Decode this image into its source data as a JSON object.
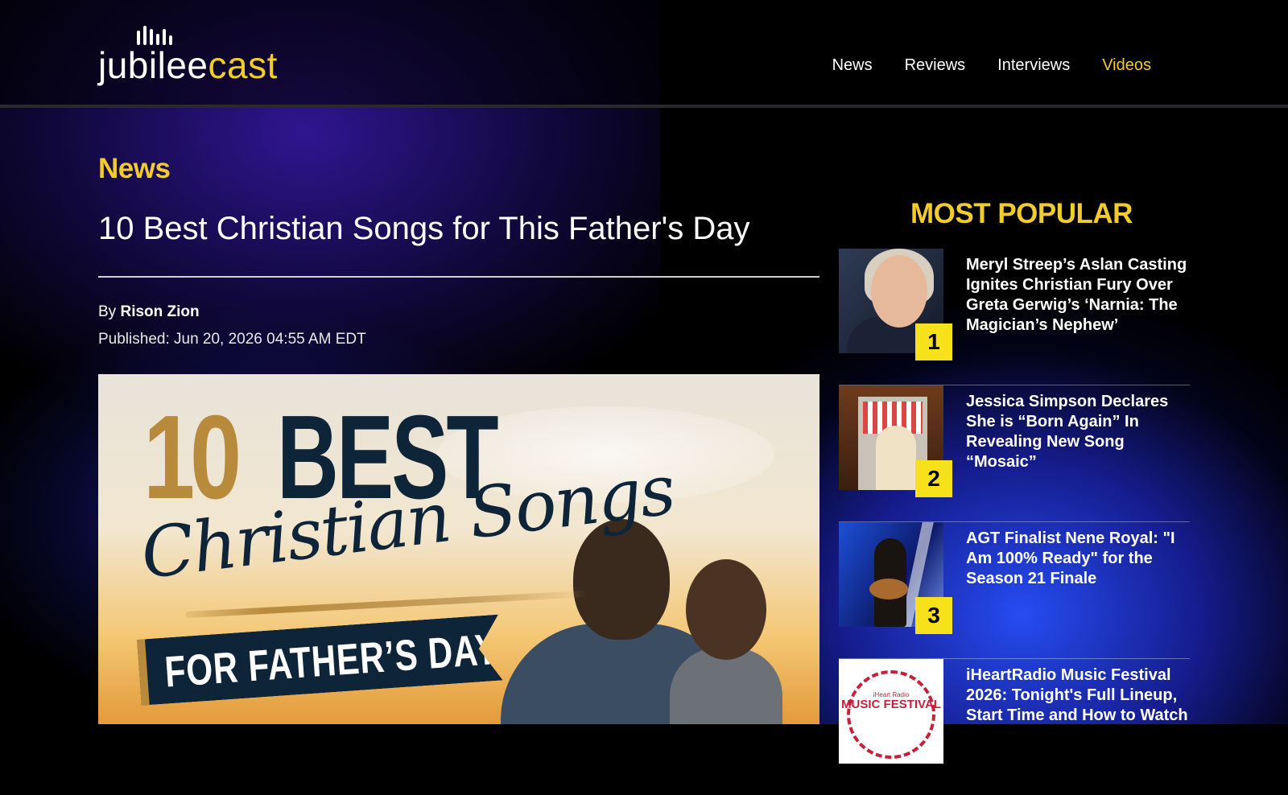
{
  "site": {
    "logo_part1": "jubilee",
    "logo_part2": "cast"
  },
  "nav": {
    "items": [
      {
        "label": "News",
        "active": false
      },
      {
        "label": "Reviews",
        "active": false
      },
      {
        "label": "Interviews",
        "active": false
      },
      {
        "label": "Videos",
        "active": true
      }
    ]
  },
  "article": {
    "category": "News",
    "title": "10 Best Christian Songs for This Father's Day",
    "by_prefix": "By",
    "author": "Rison Zion",
    "published": "Published: Jun 20, 2026 04:55 AM EDT",
    "hero": {
      "number": "10",
      "best": "BEST",
      "script": "Christian Songs",
      "ribbon": "FOR FATHER’S DAY"
    }
  },
  "popular": {
    "heading": "MOST POPULAR",
    "items": [
      {
        "rank": "1",
        "title": "Meryl Streep’s Aslan Casting Ignites Christian Fury Over Greta Gerwig’s ‘Narnia: The Magician’s Nephew’"
      },
      {
        "rank": "2",
        "title": "Jessica Simpson Declares She is “Born Again” In Revealing New Song “Mosaic”"
      },
      {
        "rank": "3",
        "title": "AGT Finalist Nene Royal: \"I Am 100% Ready\" for the Season 21 Finale"
      },
      {
        "rank": "",
        "title": "iHeartRadio Music Festival 2026: Tonight's Full Lineup, Start Time and How to Watch",
        "thumb_text_top": "iHeart Radio",
        "thumb_text_main": "MUSIC FESTIVAL"
      }
    ]
  },
  "colors": {
    "accent": "#f2cc2c",
    "rank_badge": "#f7e11a",
    "background": "#000000"
  }
}
